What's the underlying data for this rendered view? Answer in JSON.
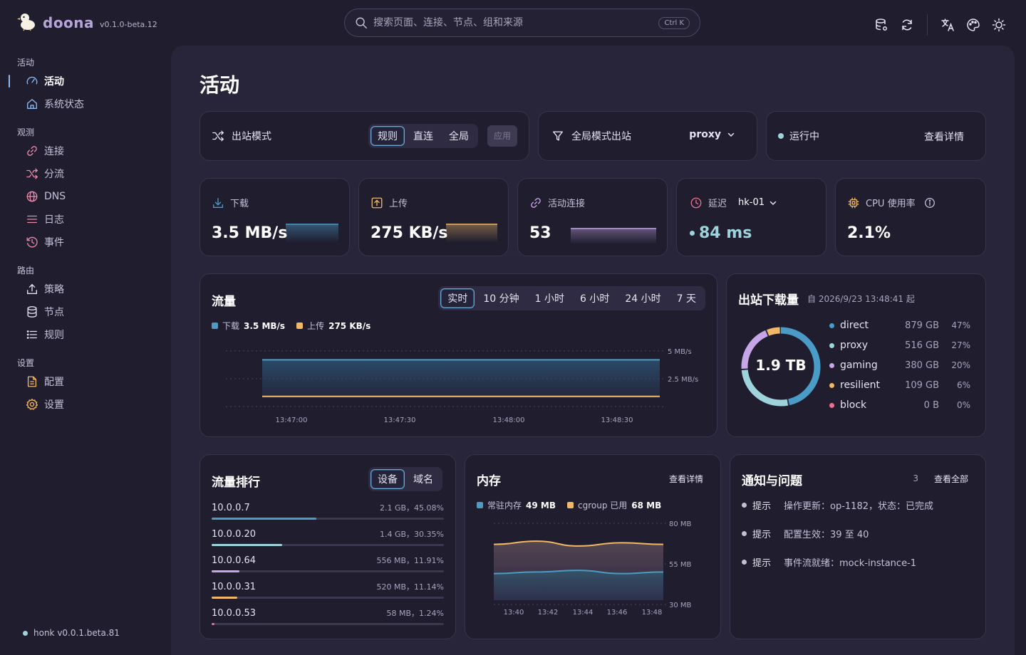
{
  "app": {
    "name": "doona",
    "version": "v0.1.0-beta.12"
  },
  "search": {
    "placeholder": "搜索页面、连接、节点、组和来源",
    "shortcut": "Ctrl K"
  },
  "sidebar": {
    "groups": [
      {
        "title": "活动",
        "items": [
          {
            "label": "活动",
            "icon": "gauge-icon"
          },
          {
            "label": "系统状态",
            "icon": "home-icon"
          }
        ]
      },
      {
        "title": "观测",
        "items": [
          {
            "label": "连接",
            "icon": "link-icon"
          },
          {
            "label": "分流",
            "icon": "shuffle-icon"
          },
          {
            "label": "DNS",
            "icon": "globe-icon"
          },
          {
            "label": "日志",
            "icon": "lines-icon"
          },
          {
            "label": "事件",
            "icon": "history-icon"
          }
        ]
      },
      {
        "title": "路由",
        "items": [
          {
            "label": "策略",
            "icon": "upload-icon"
          },
          {
            "label": "节点",
            "icon": "database-icon"
          },
          {
            "label": "规则",
            "icon": "list-icon"
          }
        ]
      },
      {
        "title": "设置",
        "items": [
          {
            "label": "配置",
            "icon": "file-icon"
          },
          {
            "label": "设置",
            "icon": "gear-icon"
          }
        ]
      }
    ],
    "footer": "honk v0.0.1.beta.81"
  },
  "page": {
    "title": "活动"
  },
  "mode": {
    "label": "出站模式",
    "options": [
      "规则",
      "直连",
      "全局"
    ],
    "selected": "规则",
    "apply": "应用"
  },
  "global_outbound": {
    "label": "全局模式出站",
    "value": "proxy"
  },
  "status": {
    "label": "运行中",
    "link": "查看详情"
  },
  "stats": {
    "download": {
      "label": "下载",
      "value": "3.5 MB/s"
    },
    "upload": {
      "label": "上传",
      "value": "275 KB/s"
    },
    "connections": {
      "label": "活动连接",
      "value": "53"
    },
    "latency": {
      "label": "延迟",
      "node": "hk-01",
      "value": "84 ms"
    },
    "cpu": {
      "label": "CPU 使用率",
      "value": "2.1%"
    }
  },
  "traffic": {
    "title": "流量",
    "ranges": [
      "实时",
      "10 分钟",
      "1 小时",
      "6 小时",
      "24 小时",
      "7 天"
    ],
    "selected": "实时",
    "legend": [
      {
        "name": "下载",
        "value": "3.5 MB/s",
        "color": "#4a9cc6"
      },
      {
        "name": "上传",
        "value": "275 KB/s",
        "color": "#f2b866"
      }
    ]
  },
  "outbound": {
    "title": "出站下载量",
    "since": "自 2026/9/23 13:48:41 起",
    "total": "1.9 TB",
    "items": [
      {
        "name": "direct",
        "size": "879 GB",
        "pct": "47%",
        "color": "#4a9cc6"
      },
      {
        "name": "proxy",
        "size": "516 GB",
        "pct": "27%",
        "color": "#9fd3dc"
      },
      {
        "name": "gaming",
        "size": "380 GB",
        "pct": "20%",
        "color": "#c7a6e8"
      },
      {
        "name": "resilient",
        "size": "109 GB",
        "pct": "6%",
        "color": "#f2b866"
      },
      {
        "name": "block",
        "size": "0 B",
        "pct": "0%",
        "color": "#ec6f8e"
      }
    ]
  },
  "ranking": {
    "title": "流量排行",
    "tabs": [
      "设备",
      "域名"
    ],
    "selected": "设备",
    "rows": [
      {
        "ip": "10.0.0.7",
        "value": "2.1 GB，45.08%",
        "fill": 0.4508,
        "color": "#4a9cc6"
      },
      {
        "ip": "10.0.0.20",
        "value": "1.4 GB，30.35%",
        "fill": 0.3035,
        "color": "#9fd3dc"
      },
      {
        "ip": "10.0.0.64",
        "value": "556 MB，11.91%",
        "fill": 0.1191,
        "color": "#c7a6e8"
      },
      {
        "ip": "10.0.0.31",
        "value": "520 MB，11.14%",
        "fill": 0.1114,
        "color": "#f2b866"
      },
      {
        "ip": "10.0.0.53",
        "value": "58 MB，1.24%",
        "fill": 0.0124,
        "color": "#ec6f8e"
      }
    ]
  },
  "memory": {
    "title": "内存",
    "link": "查看详情",
    "legend": [
      {
        "name": "常驻内存",
        "value": "49 MB",
        "color": "#4a9cc6"
      },
      {
        "name": "cgroup 已用",
        "value": "68 MB",
        "color": "#f2b866"
      }
    ]
  },
  "notices": {
    "title": "通知与问题",
    "count": "3",
    "link": "查看全部",
    "items": [
      {
        "level": "提示",
        "message": "操作更新：op-1182，状态：已完成"
      },
      {
        "level": "提示",
        "message": "配置生效：39 至 40"
      },
      {
        "level": "提示",
        "message": "事件流就绪：mock-instance-1"
      }
    ]
  },
  "chart_data": [
    {
      "type": "area",
      "x": [
        "13:47:00",
        "13:47:30",
        "13:48:00",
        "13:48:30"
      ],
      "xlabel": "",
      "ylabel": "",
      "yticks": [
        "5 MB/s",
        "2.5 MB/s"
      ],
      "ylim": [
        0,
        5.5
      ],
      "series": [
        {
          "name": "下载",
          "values": [
            4.2,
            4.2,
            4.2,
            4.2
          ],
          "color": "#4a9cc6"
        },
        {
          "name": "上传",
          "values": [
            0.27,
            0.27,
            0.27,
            0.27
          ],
          "color": "#f2b866"
        }
      ],
      "grid": true
    },
    {
      "type": "pie",
      "categories": [
        "direct",
        "proxy",
        "gaming",
        "resilient",
        "block"
      ],
      "values": [
        47,
        27,
        20,
        6,
        0
      ]
    },
    {
      "type": "area",
      "x": [
        "13:40",
        "13:42",
        "13:44",
        "13:46",
        "13:48"
      ],
      "yticks": [
        "80 MB",
        "55 MB",
        "30 MB"
      ],
      "ylim": [
        30,
        80
      ],
      "series": [
        {
          "name": "常驻内存",
          "values": [
            49,
            50,
            51,
            49,
            50
          ],
          "color": "#4a9cc6"
        },
        {
          "name": "cgroup 已用",
          "values": [
            67,
            69,
            66,
            68,
            67
          ],
          "color": "#f2b866"
        }
      ],
      "grid": true
    }
  ]
}
